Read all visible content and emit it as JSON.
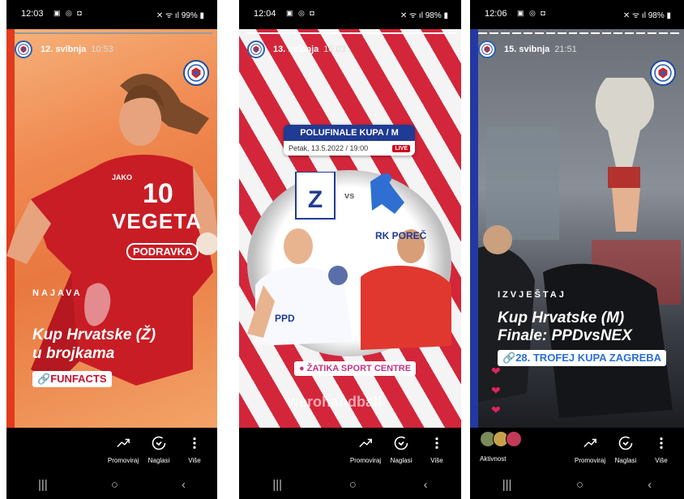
{
  "phones": [
    {
      "status": {
        "time": "12:03",
        "battery": "99%"
      },
      "story": {
        "date": "12. svibnja",
        "time": "10:53",
        "category": "NAJAVA",
        "title_line1": "Kup Hrvatske (Ž)",
        "title_line2": "u brojkama",
        "link_label": "FUNFACTS",
        "jersey_number": "10",
        "jersey_sponsor": "VEGETA",
        "jersey_logo": "PODRAVKA",
        "jersey_brand": "JAKO"
      },
      "actions": [
        "Promoviraj",
        "Naglasi",
        "Više"
      ]
    },
    {
      "status": {
        "time": "12:04",
        "battery": "98%"
      },
      "story": {
        "date": "13. svibnja",
        "time": "16:03",
        "banner_title": "POLUFINALE KUPA / M",
        "banner_date": "Petak, 13.5.2022 / 19:00",
        "live": "LIVE",
        "vs": "vs",
        "team2": "RK POREČ",
        "jersey_sponsor": "PPD",
        "location": "ŽATIKA SPORT CENTRE",
        "watermark": "werohandball"
      },
      "actions": [
        "Promoviraj",
        "Naglasi",
        "Više"
      ]
    },
    {
      "status": {
        "time": "12:06",
        "battery": "98%"
      },
      "story": {
        "date": "15. svibnja",
        "time": "21:51",
        "category": "IZVJEŠTAJ",
        "title_line1": "Kup Hrvatske (M)",
        "title_line2": "Finale: PPDvsNEX",
        "link_label": "28. TROFEJ KUPA ZAGREBA"
      },
      "activity_label": "Aktivnost",
      "actions": [
        "Promoviraj",
        "Naglasi",
        "Više"
      ]
    }
  ],
  "nav": {
    "recent": "|||",
    "home": "○",
    "back": "‹"
  },
  "colors": {
    "story_red": "#c8102e",
    "story_blue": "#1d3e8c",
    "link_bg": "#ffffff"
  }
}
